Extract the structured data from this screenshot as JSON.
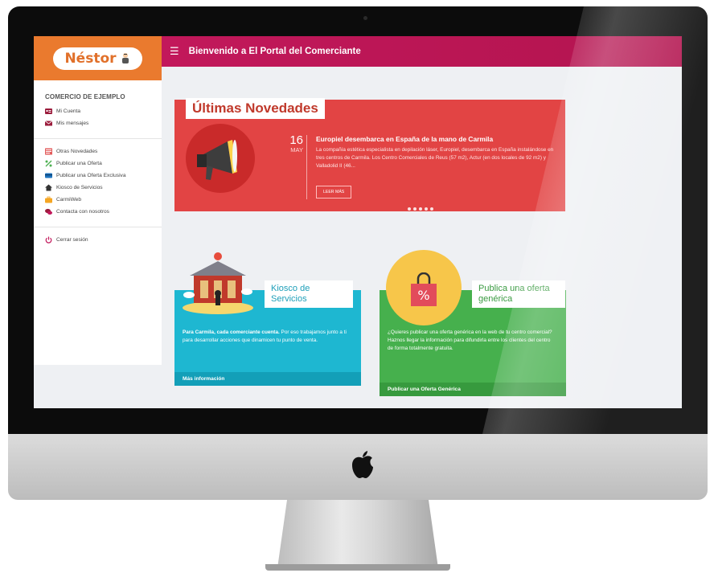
{
  "app": {
    "logo_text": "Néstor",
    "header_title": "Bienvenido a El Portal del Comerciante"
  },
  "sidebar": {
    "company": "COMERCIO DE EJEMPLO",
    "account_items": [
      {
        "label": "Mi Cuenta",
        "icon": "id-card-icon"
      },
      {
        "label": "Mis mensajes",
        "icon": "envelope-icon"
      }
    ],
    "nav_items": [
      {
        "label": "Otras Novedades",
        "icon": "newspaper-icon"
      },
      {
        "label": "Publicar una Oferta",
        "icon": "percent-icon"
      },
      {
        "label": "Publicar una Oferta Exclusiva",
        "icon": "credit-card-icon"
      },
      {
        "label": "Kiosco de Servicios",
        "icon": "home-icon"
      },
      {
        "label": "CarmiWeb",
        "icon": "briefcase-icon"
      },
      {
        "label": "Contacta con nosotros",
        "icon": "chat-icon"
      }
    ],
    "logout": "Cerrar sesión"
  },
  "news": {
    "section_title": "Últimas Novedades",
    "day": "16",
    "month": "MAY",
    "title": "Europiel desembarca en España de la mano de Carmila",
    "body": "La compañía estética especialista en depilación láser, Europiel, desembarca en España instalándose en tres centros de Carmila. Los Centro Comerciales de Reus (57 m2), Actur (en dos locales de 92 m2) y Valladolid II (46...",
    "button": "LEER MÁS",
    "slides": 5
  },
  "kiosk_card": {
    "title": "Kiosco de Servicios",
    "body_bold": "Para Carmila, cada comerciante cuenta.",
    "body": " Por eso trabajamos junto a ti para desarrollar acciones que dinamicen tu punto de venta.",
    "footer": "Más información"
  },
  "promo_card": {
    "title": "Publica una oferta genérica",
    "body": "¿Quieres publicar una oferta genérica en la web de tu centro comercial? Haznos llegar la información para difundirla entre los clientes del centro de forma totalmente gratuita.",
    "footer": "Publicar una Oferta Genérica"
  },
  "colors": {
    "header": "#c2185b",
    "logo_bg": "#ea7a2e",
    "news": "#e24444",
    "kiosk": "#1eb7d1",
    "promo": "#46b04d"
  }
}
